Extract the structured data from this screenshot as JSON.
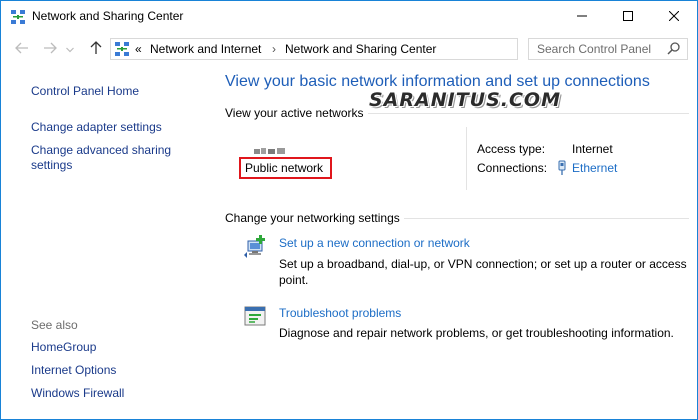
{
  "window": {
    "title": "Network and Sharing Center",
    "icons": {
      "app": "network-icon",
      "minimize": "minimize-icon",
      "maximize": "maximize-icon",
      "close": "close-icon"
    }
  },
  "navigation": {
    "back_icon": "arrow-left-icon",
    "forward_icon": "arrow-right-icon",
    "recent_icon": "chevron-down-icon",
    "up_icon": "arrow-up-icon",
    "overflow": "«",
    "breadcrumb": [
      "Network and Internet",
      "Network and Sharing Center"
    ],
    "separator": "›",
    "refresh_icon": "refresh-icon",
    "search_placeholder": "Search Control Panel",
    "search_icon": "search-icon"
  },
  "sidebar": {
    "links": [
      "Control Panel Home",
      "Change adapter settings",
      "Change advanced sharing settings"
    ],
    "see_also_label": "See also",
    "see_also": [
      "HomeGroup",
      "Internet Options",
      "Windows Firewall"
    ]
  },
  "main": {
    "heading": "View your basic network information and set up connections",
    "active_networks_label": "View your active networks",
    "network": {
      "category": "Public network",
      "access_type_label": "Access type:",
      "access_type": "Internet",
      "connections_label": "Connections:",
      "connection": "Ethernet",
      "connection_icon": "ethernet-icon"
    },
    "change_settings_label": "Change your networking settings",
    "tasks": [
      {
        "title": "Set up a new connection or network",
        "description": "Set up a broadband, dial-up, or VPN connection; or set up a router or access point.",
        "icon": "new-connection-icon"
      },
      {
        "title": "Troubleshoot problems",
        "description": "Diagnose and repair network problems, or get troubleshooting information.",
        "icon": "troubleshoot-icon"
      }
    ]
  },
  "watermark": "SARANITUS.COM",
  "colors": {
    "heading": "#1e5eb8",
    "link": "#1c6dc6",
    "sidebar_link": "#1a3a8a",
    "highlight_border": "#e0161c",
    "window_border": "#1883d7"
  }
}
